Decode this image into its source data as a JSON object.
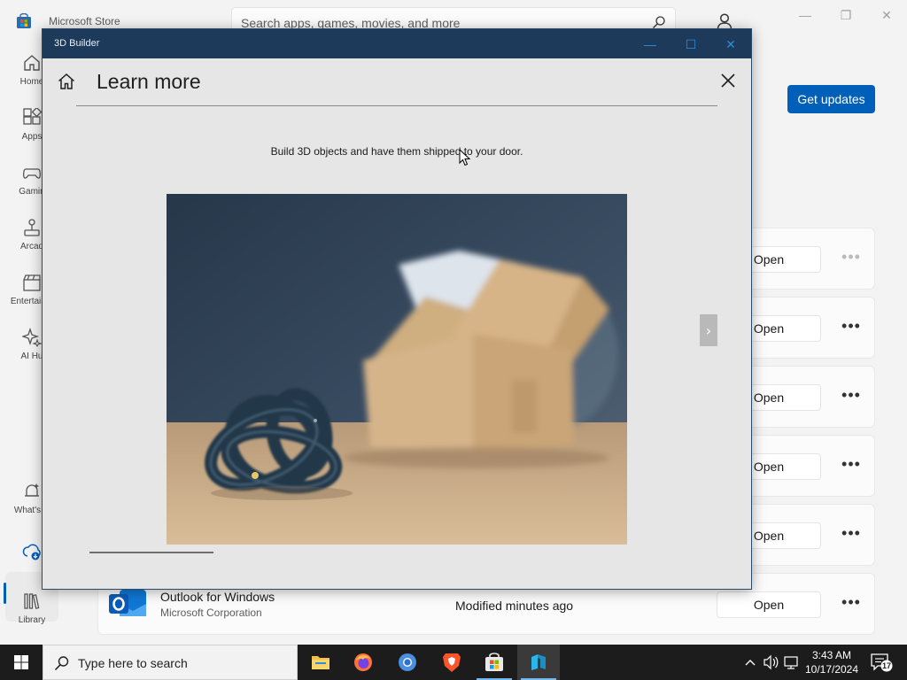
{
  "store": {
    "title": "Microsoft Store",
    "search_placeholder": "Search apps, games, movies, and more",
    "get_updates_label": "Get updates",
    "nav": [
      {
        "label": "Home"
      },
      {
        "label": "Apps"
      },
      {
        "label": "Gamin"
      },
      {
        "label": "Arcad"
      },
      {
        "label": "Entertainm"
      },
      {
        "label": "AI Hu"
      },
      {
        "label": "What's N"
      },
      {
        "label": ""
      },
      {
        "label": "Library"
      }
    ],
    "rows": [
      {
        "open_label": "Open",
        "more": "•••"
      },
      {
        "open_label": "Open",
        "more": "•••"
      },
      {
        "open_label": "Open",
        "more": "•••"
      },
      {
        "open_label": "Open",
        "more": "•••"
      },
      {
        "open_label": "Open",
        "more": "•••"
      },
      {
        "name": "Outlook for Windows",
        "publisher": "Microsoft Corporation",
        "modified": "Modified minutes ago",
        "open_label": "Open",
        "more": "•••"
      }
    ]
  },
  "builder": {
    "window_title": "3D Builder",
    "controls": {
      "minimize": "—",
      "maximize": "☐",
      "close": "✕"
    },
    "page_title": "Learn more",
    "description": "Build 3D objects and have them shipped to your door.",
    "next_glyph": "›",
    "slide_progress": 1.0
  },
  "taskbar": {
    "search_text": "Type here to search",
    "time": "3:43 AM",
    "date": "10/17/2024",
    "notification_count": "17"
  },
  "colors": {
    "accent": "#005fb8",
    "builder_titlebar": "#1e3a5a",
    "taskbar": "#1c1c1c"
  }
}
